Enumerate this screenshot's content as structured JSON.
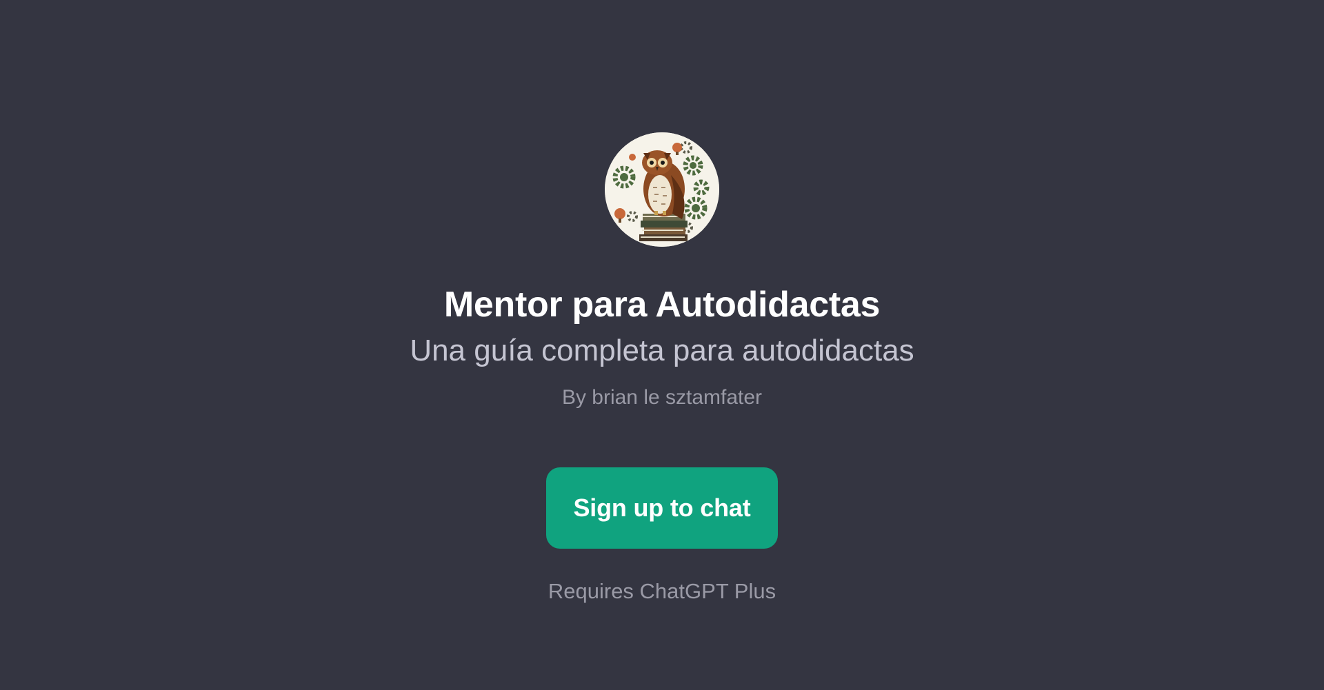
{
  "gpt": {
    "title": "Mentor para Autodidactas",
    "description": "Una guía completa para autodidactas",
    "author": "By brian le sztamfater"
  },
  "actions": {
    "signup_label": "Sign up to chat",
    "requirement_note": "Requires ChatGPT Plus"
  },
  "avatar": {
    "icon": "owl-on-books-with-gears-icon"
  },
  "colors": {
    "background": "#343541",
    "accent": "#10a37f",
    "title": "#ffffff",
    "subtitle": "#c5c5d2",
    "muted": "#9a9aa6"
  }
}
